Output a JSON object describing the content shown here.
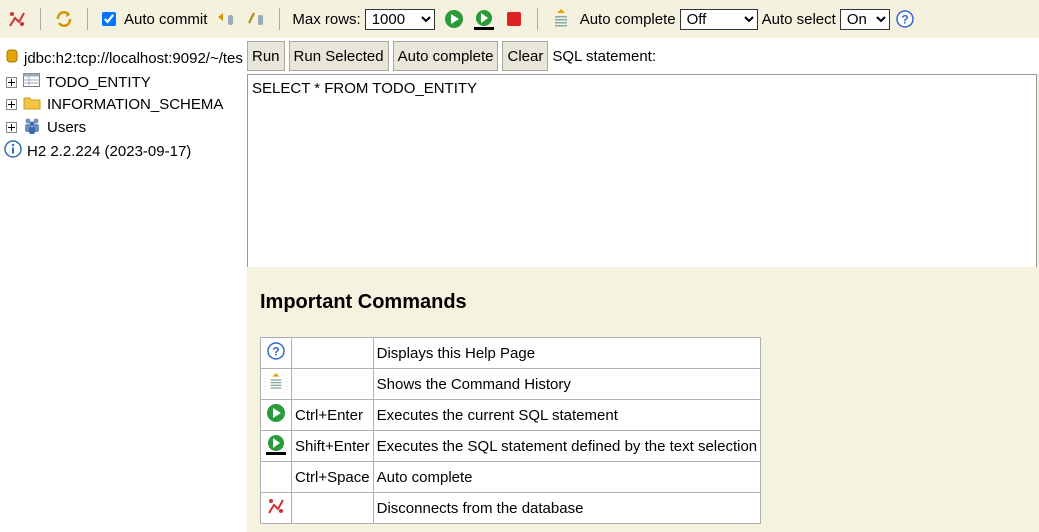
{
  "toolbar": {
    "auto_commit_label": "Auto commit",
    "max_rows_label": "Max rows:",
    "max_rows_value": "1000",
    "auto_complete_label": "Auto complete",
    "auto_complete_value": "Off",
    "auto_select_label": "Auto select",
    "auto_select_value": "On"
  },
  "tree": {
    "connection": "jdbc:h2:tcp://localhost:9092/~/tes",
    "items": [
      "TODO_ENTITY",
      "INFORMATION_SCHEMA",
      "Users"
    ],
    "version": "H2 2.2.224 (2023-09-17)"
  },
  "query_bar": {
    "run": "Run",
    "run_selected": "Run Selected",
    "auto_complete": "Auto complete",
    "clear": "Clear",
    "sql_statement_label": "SQL statement:"
  },
  "sql_text": "SELECT * FROM TODO_ENTITY",
  "help": {
    "title": "Important Commands",
    "rows": [
      {
        "icon": "help-icon",
        "key": "",
        "desc": "Displays this Help Page"
      },
      {
        "icon": "history-icon",
        "key": "",
        "desc": "Shows the Command History"
      },
      {
        "icon": "run-icon",
        "key": "Ctrl+Enter",
        "desc": "Executes the current SQL statement"
      },
      {
        "icon": "run-selected-icon",
        "key": "Shift+Enter",
        "desc": "Executes the SQL statement defined by the text selection"
      },
      {
        "icon": "",
        "key": "Ctrl+Space",
        "desc": "Auto complete"
      },
      {
        "icon": "disconnect-icon",
        "key": "",
        "desc": "Disconnects from the database"
      }
    ]
  }
}
